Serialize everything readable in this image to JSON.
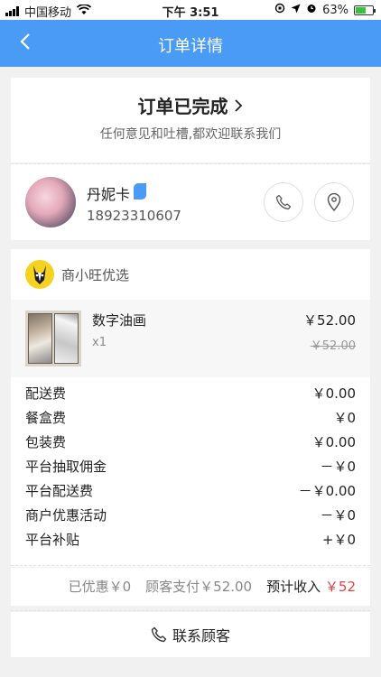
{
  "status_bar": {
    "carrier": "中国移动",
    "time": "下午 3:51",
    "battery": "63%",
    "battery_level": 0.63
  },
  "nav": {
    "title": "订单详情"
  },
  "order_status": {
    "title": "订单已完成",
    "subtitle": "任何意见和吐槽,都欢迎联系我们"
  },
  "customer": {
    "name": "丹妮卡",
    "phone": "18923310607"
  },
  "shop": {
    "name": "商小旺优选"
  },
  "product": {
    "name": "数字油画",
    "qty": "x1",
    "price": "￥52.00",
    "original_price": "￥52.00"
  },
  "fees": [
    {
      "label": "配送费",
      "value": "￥0.00"
    },
    {
      "label": "餐盒费",
      "value": "￥0"
    },
    {
      "label": "包装费",
      "value": "￥0.00"
    },
    {
      "label": "平台抽取佣金",
      "value": "－￥0"
    },
    {
      "label": "平台配送费",
      "value": "－￥0.00"
    },
    {
      "label": "商户优惠活动",
      "value": "－￥0"
    },
    {
      "label": "平台补贴",
      "value": "+￥0"
    }
  ],
  "summary": {
    "discount": "已优惠￥0",
    "paid": "顾客支付￥52.00",
    "income_label": "预计收入",
    "income_value": "￥52"
  },
  "contact": {
    "label": "联系顾客"
  },
  "colors": {
    "nav_blue": "#4a9bf6",
    "income_red": "#e64141"
  }
}
